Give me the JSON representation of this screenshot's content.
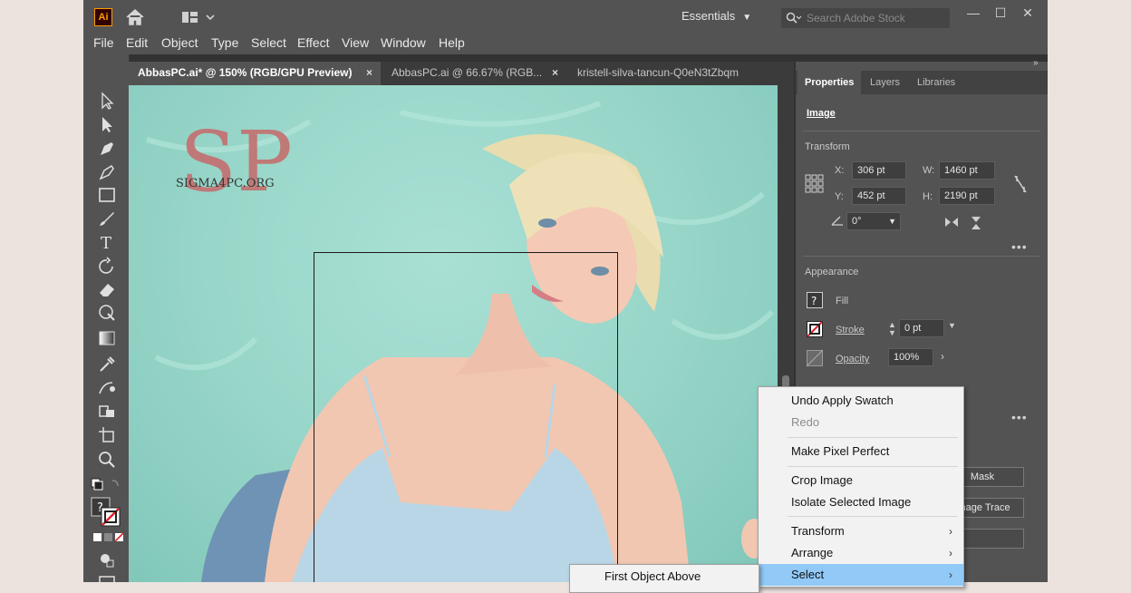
{
  "app": {
    "logo": "Ai",
    "workspace": "Essentials",
    "search_placeholder": "Search Adobe Stock",
    "window_buttons": [
      "—",
      "☐",
      "✕"
    ]
  },
  "menubar": [
    "File",
    "Edit",
    "Object",
    "Type",
    "Select",
    "Effect",
    "View",
    "Window",
    "Help"
  ],
  "tabs": [
    {
      "label": "AbbasPC.ai* @ 150% (RGB/GPU Preview)",
      "active": true
    },
    {
      "label": "AbbasPC.ai @ 66.67% (RGB...",
      "active": false
    },
    {
      "label": "kristell-silva-tancun-Q0eN3tZbqm",
      "active": false
    }
  ],
  "watermark": {
    "letters": "SP",
    "site": "SIGMA4PC.ORG"
  },
  "properties": {
    "tabs": [
      "Properties",
      "Layers",
      "Libraries"
    ],
    "object_type": "Image",
    "transform": {
      "title": "Transform",
      "x_label": "X:",
      "x": "306 pt",
      "y_label": "Y:",
      "y": "452 pt",
      "w_label": "W:",
      "w": "1460 pt",
      "h_label": "H:",
      "h": "2190 pt",
      "angle": "0°"
    },
    "appearance": {
      "title": "Appearance",
      "fill_label": "Fill",
      "stroke_label": "Stroke",
      "stroke_value": "0 pt",
      "opacity_label": "Opacity",
      "opacity_value": "100%"
    },
    "buttons": {
      "mask": "Mask",
      "image_trace": "Image Trace"
    }
  },
  "context_menu": {
    "items": [
      {
        "label": "Undo Apply Swatch",
        "disabled": false
      },
      {
        "label": "Redo",
        "disabled": true
      },
      {
        "label": "Make Pixel Perfect",
        "disabled": false
      },
      {
        "label": "Crop Image",
        "disabled": false
      },
      {
        "label": "Isolate Selected Image",
        "disabled": false
      },
      {
        "label": "Transform",
        "submenu": true
      },
      {
        "label": "Arrange",
        "submenu": true
      },
      {
        "label": "Select",
        "submenu": true,
        "active": true
      }
    ],
    "submenu_items": [
      "First Object Above"
    ]
  }
}
